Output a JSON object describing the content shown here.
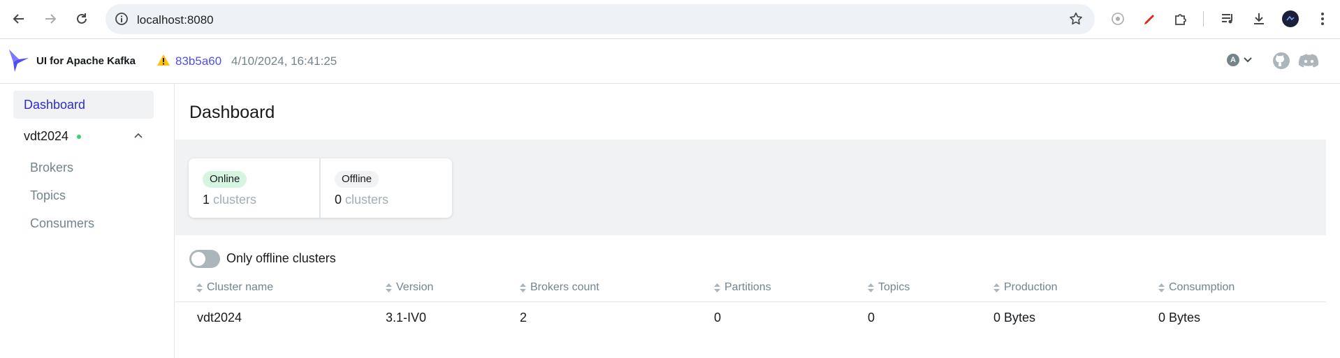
{
  "browser": {
    "url": "localhost:8080"
  },
  "header": {
    "brand": "UI for Apache Kafka",
    "commit": "83b5a60",
    "build_date": "4/10/2024, 16:41:25",
    "user_initial": "A"
  },
  "sidebar": {
    "dashboard_label": "Dashboard",
    "cluster_name": "vdt2024",
    "cluster_status_color": "#3bd16f",
    "items": [
      {
        "label": "Brokers"
      },
      {
        "label": "Topics"
      },
      {
        "label": "Consumers"
      }
    ]
  },
  "main": {
    "title": "Dashboard",
    "online": {
      "badge": "Online",
      "count": "1",
      "unit": "clusters"
    },
    "offline": {
      "badge": "Offline",
      "count": "0",
      "unit": "clusters"
    },
    "toggle_label": "Only offline clusters",
    "toggle_on": false,
    "columns": [
      "Cluster name",
      "Version",
      "Brokers count",
      "Partitions",
      "Topics",
      "Production",
      "Consumption"
    ],
    "rows": [
      [
        "vdt2024",
        "3.1-IV0",
        "2",
        "0",
        "0",
        "0 Bytes",
        "0 Bytes"
      ]
    ]
  },
  "colors": {
    "accent": "#4f4ff0",
    "online_badge": "#d6f5e0"
  }
}
